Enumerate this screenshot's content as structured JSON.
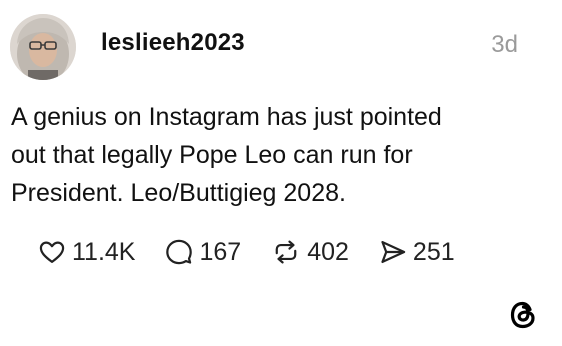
{
  "post": {
    "username": "leslieeh2023",
    "time_ago": "3d",
    "text": "A genius on Instagram has just pointed\nout that legally Pope Leo can run for\nPresident.  Leo/Buttigieg 2028."
  },
  "actions": {
    "likes": "11.4K",
    "replies": "167",
    "reposts": "402",
    "shares": "251"
  },
  "icons": {
    "like": "heart-icon",
    "reply": "speech-bubble-icon",
    "repost": "repost-icon",
    "share": "send-icon",
    "brand": "threads-logo-icon"
  }
}
